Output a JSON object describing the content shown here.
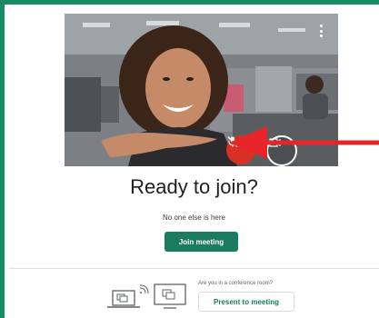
{
  "preview": {
    "more_icon": "more-vert-icon",
    "mic_icon": "mic-off-icon",
    "camera_icon": "camera-icon"
  },
  "main": {
    "title": "Ready to join?",
    "status": "No one else is here",
    "join_label": "Join meeting"
  },
  "conference": {
    "prompt": "Are you in a conference room?",
    "present_label": "Present to meeting",
    "icons": [
      "laptop-cast-icon",
      "tv-cast-icon"
    ]
  },
  "colors": {
    "accent": "#1b7c60",
    "frame": "#188a66",
    "mic_off": "#d93025",
    "annotation_arrow": "#e8242b"
  }
}
